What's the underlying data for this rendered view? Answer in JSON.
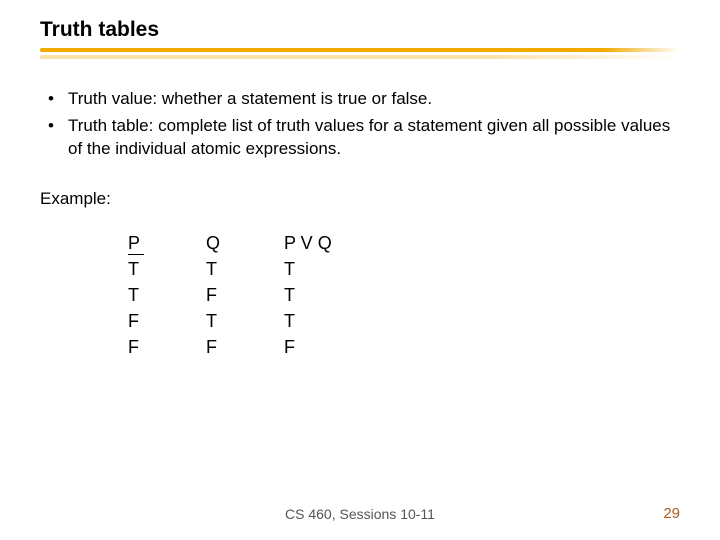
{
  "title": "Truth tables",
  "bullets": [
    "Truth value: whether a statement is true or false.",
    "Truth table: complete list of truth values for a statement given all possible values of the individual atomic expressions."
  ],
  "example_label": "Example:",
  "table": {
    "headers": [
      "P",
      "Q",
      "P V Q"
    ],
    "rows": [
      [
        "T",
        "T",
        "T"
      ],
      [
        "T",
        "F",
        "T"
      ],
      [
        "F",
        "T",
        "T"
      ],
      [
        "F",
        "F",
        "F"
      ]
    ]
  },
  "footer": "CS 460,  Sessions 10-11",
  "page_number": "29"
}
